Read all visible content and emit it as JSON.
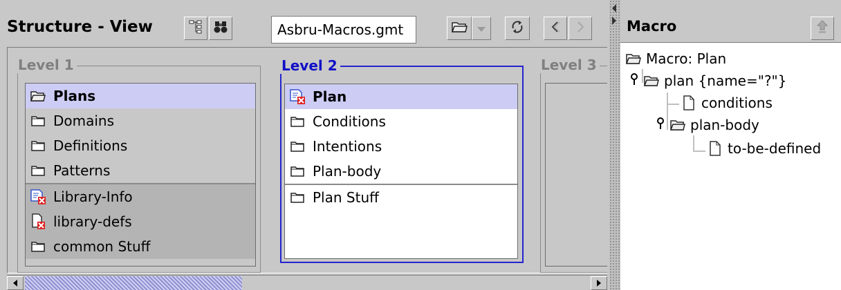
{
  "structure_view": {
    "title": "Structure - View",
    "file_name": "Asbru-Macros.gmt",
    "toolbar_icons": [
      "tree-view-icon",
      "binoculars-icon",
      "folder-open-icon",
      "dropdown-arrow-icon",
      "refresh-icon",
      "back-icon",
      "forward-icon"
    ],
    "levels": [
      {
        "title": "Level 1",
        "items": [
          {
            "label": "Plans",
            "icon": "folder-open-icon",
            "selected": true
          },
          {
            "label": "Domains",
            "icon": "folder-icon"
          },
          {
            "label": "Definitions",
            "icon": "folder-icon"
          },
          {
            "label": "Patterns",
            "icon": "folder-icon"
          },
          {
            "label": "Library-Info",
            "icon": "error-document-icon"
          },
          {
            "label": "library-defs",
            "icon": "error-file-icon"
          },
          {
            "label": "common Stuff",
            "icon": "folder-icon"
          }
        ]
      },
      {
        "title": "Level 2",
        "items": [
          {
            "label": "Plan",
            "icon": "error-document-icon",
            "selected": true
          },
          {
            "label": "Conditions",
            "icon": "folder-icon"
          },
          {
            "label": "Intentions",
            "icon": "folder-icon"
          },
          {
            "label": "Plan-body",
            "icon": "folder-icon"
          },
          {
            "label": "Plan Stuff",
            "icon": "folder-icon"
          }
        ]
      },
      {
        "title": "Level 3",
        "items": []
      }
    ]
  },
  "macro": {
    "title": "Macro",
    "header_icon": "export-icon",
    "tree": [
      {
        "label": "Macro: Plan",
        "icon": "folder-open-icon"
      },
      {
        "label": "plan {name=\"?\"}",
        "icon": "folder-open-icon"
      },
      {
        "label": "conditions",
        "icon": "document-icon"
      },
      {
        "label": "plan-body",
        "icon": "folder-open-icon"
      },
      {
        "label": "to-be-defined",
        "icon": "document-icon"
      }
    ]
  },
  "colors": {
    "panel_bg": "#c8c8c8",
    "selection": "#ccccf4",
    "active_group_border": "#2424d0",
    "error_red": "#dd2222"
  }
}
